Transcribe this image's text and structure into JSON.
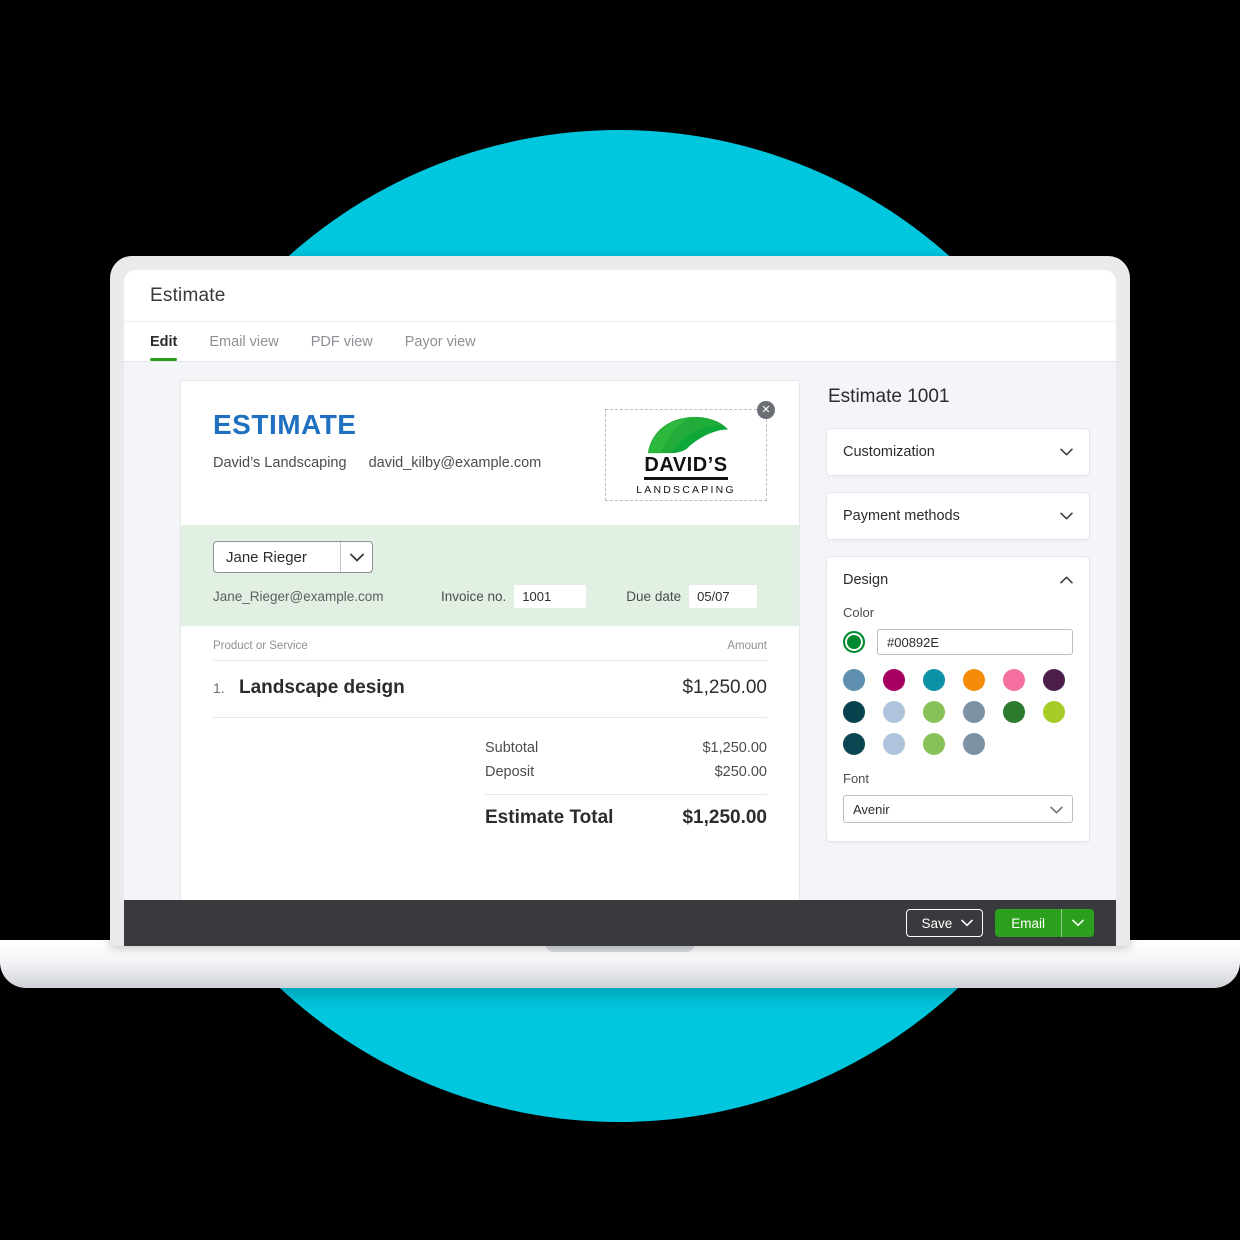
{
  "app": {
    "title": "Estimate",
    "tabs": [
      {
        "label": "Edit",
        "active": true
      },
      {
        "label": "Email view",
        "active": false
      },
      {
        "label": "PDF view",
        "active": false
      },
      {
        "label": "Payor view",
        "active": false
      }
    ]
  },
  "document": {
    "type_label": "ESTIMATE",
    "business_name": "David’s Landscaping",
    "business_email": "david_kilby@example.com",
    "logo": {
      "name": "DAVID’S",
      "subtitle": "LANDSCAPING",
      "remove_label": "✕"
    },
    "customer": {
      "name": "Jane Rieger",
      "email": "Jane_Rieger@example.com",
      "invoice_no_label": "Invoice no.",
      "invoice_no_value": "1001",
      "due_date_label": "Due date",
      "due_date_value": "05/07"
    },
    "table": {
      "col_product": "Product or Service",
      "col_amount": "Amount",
      "rows": [
        {
          "index": "1.",
          "name": "Landscape design",
          "amount": "$1,250.00"
        }
      ]
    },
    "totals": {
      "subtotal_label": "Subtotal",
      "subtotal_value": "$1,250.00",
      "deposit_label": "Deposit",
      "deposit_value": "$250.00",
      "total_label": "Estimate Total",
      "total_value": "$1,250.00"
    }
  },
  "sidebar": {
    "title": "Estimate 1001",
    "sections": [
      {
        "label": "Customization",
        "expanded": false
      },
      {
        "label": "Payment methods",
        "expanded": false
      },
      {
        "label": "Design",
        "expanded": true
      }
    ],
    "design": {
      "color_label": "Color",
      "color_value": "#00892E",
      "current_color": "#00892E",
      "swatches": [
        "#5E8FAE",
        "#A60063",
        "#0D91A4",
        "#F58A0B",
        "#F570A0",
        "#4B1E4B",
        "#08424F",
        "#AFC3DC",
        "#86C259",
        "#7D91A4",
        "#2C7A2C",
        "#A8CB28",
        "#0C4552",
        "#AFC3DC",
        "#86C259",
        "#7D91A4"
      ],
      "font_label": "Font",
      "font_value": "Avenir"
    }
  },
  "actionbar": {
    "save_label": "Save",
    "email_label": "Email"
  },
  "theme": {
    "accent_green": "#2CA01C",
    "estimate_blue": "#1F70C1",
    "background_cyan": "#00C6DE",
    "toolbar_dark": "#393a3d"
  }
}
